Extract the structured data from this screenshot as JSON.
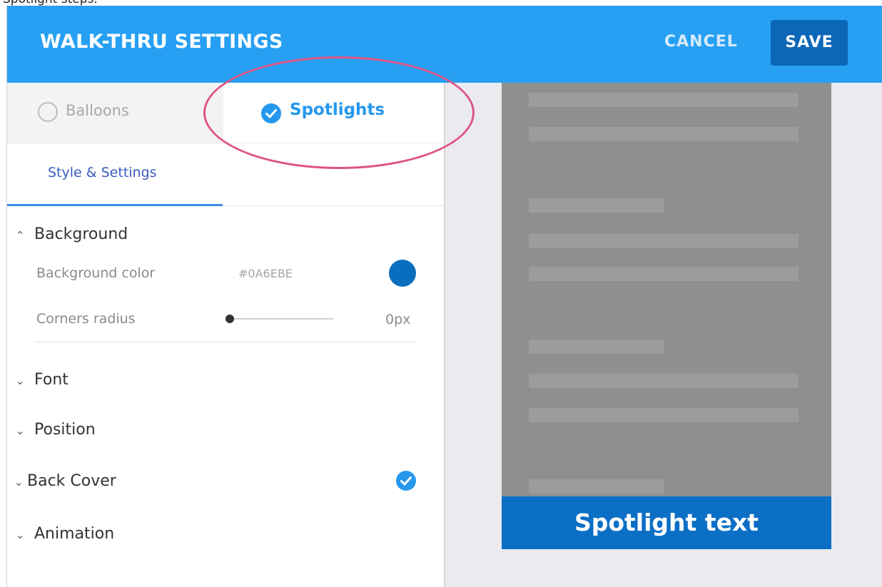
{
  "page_top_caption": "Spotlight steps.",
  "header": {
    "title": "WALK-THRU SETTINGS",
    "cancel_label": "CANCEL",
    "save_label": "SAVE"
  },
  "mode_tabs": {
    "balloons_label": "Balloons",
    "spotlights_label": "Spotlights",
    "selected": "Spotlights"
  },
  "sub_tab": {
    "label": "Style & Settings"
  },
  "sections": {
    "background": {
      "title": "Background",
      "expanded": true,
      "background_color_label": "Background color",
      "background_color_value": "#0A6EBE",
      "corners_radius_label": "Corners radius",
      "corners_radius_value": "0px",
      "corners_radius_level": 0
    },
    "font": {
      "title": "Font",
      "expanded": false
    },
    "position": {
      "title": "Position",
      "expanded": false
    },
    "back_cover": {
      "title": "Back Cover",
      "expanded": false,
      "enabled": true
    },
    "animation": {
      "title": "Animation",
      "expanded": false
    }
  },
  "preview": {
    "spotlight_text": "Spotlight text"
  },
  "icons": {
    "expanded_chevron": "chevron-up-icon",
    "collapsed_chevron": "chevron-down-icon",
    "check": "check-circle-icon",
    "radio": "radio-empty-icon"
  },
  "colors": {
    "header": "#27A0F3",
    "save_button": "#0C67B8",
    "accent": "#2598EE",
    "highlight_ring": "#DE5485",
    "spotlight_banner": "#0C6FC6"
  }
}
